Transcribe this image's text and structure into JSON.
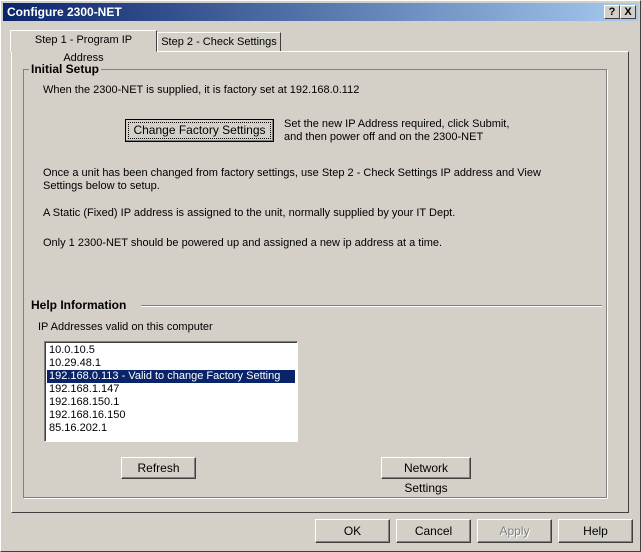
{
  "window": {
    "title": "Configure 2300-NET",
    "help_glyph": "?",
    "close_glyph": "X"
  },
  "tabs": [
    {
      "label": "Step 1 - Program IP Address",
      "active": true
    },
    {
      "label": "Step 2 - Check Settings",
      "active": false
    }
  ],
  "initial_setup": {
    "title": "Initial Setup",
    "supplied_text": "When the 2300-NET is supplied, it is factory set at 192.168.0.112",
    "change_button": "Change Factory Settings",
    "change_hint_line1": "Set the new IP Address required, click Submit,",
    "change_hint_line2": "and then power off and on the 2300-NET",
    "para1_line1": "Once a unit has been changed from factory settings, use Step 2 - Check Settings IP address and View",
    "para1_line2": "Settings below to setup.",
    "para2": "A Static (Fixed) IP address is assigned to the unit, normally supplied by your IT Dept.",
    "para3": "Only 1 2300-NET should be powered up and assigned a new ip address at a time."
  },
  "help_info": {
    "title": "Help Information",
    "list_label": "IP Addresses valid on this computer",
    "ip_list": [
      "10.0.10.5",
      "10.29.48.1",
      "192.168.0.113  - Valid to change Factory Setting",
      "192.168.1.147",
      "192.168.150.1",
      "192.168.16.150",
      "85.16.202.1"
    ],
    "selected_index": 2,
    "refresh_button": "Refresh",
    "network_button": "Network Settings"
  },
  "footer": {
    "ok": "OK",
    "cancel": "Cancel",
    "apply": "Apply",
    "help": "Help"
  }
}
